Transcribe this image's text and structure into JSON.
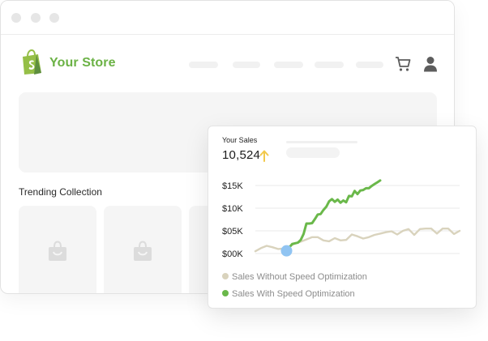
{
  "store": {
    "name": "Your Store",
    "brand_color": "#6bb245",
    "logo_icon": "shopify-bag-icon"
  },
  "header": {
    "icons": [
      "cart-icon",
      "user-icon"
    ]
  },
  "trending": {
    "title": "Trending Collection"
  },
  "sales_card": {
    "label": "Your Sales",
    "value": "10,524",
    "trend_icon": "up-arrow-icon",
    "trend_color": "#f2c94c"
  },
  "chart_data": {
    "type": "line",
    "y_tick_labels": [
      "$15K",
      "$10K",
      "$05K",
      "$00K"
    ],
    "y_ticks": [
      15,
      10,
      5,
      0
    ],
    "ylim": [
      0,
      15
    ],
    "xlim": [
      0,
      36
    ],
    "grid": true,
    "legend_placement": "bottom-left",
    "marker": {
      "x": 5.5,
      "y": 0.6,
      "color": "#90c4f2"
    },
    "series": [
      {
        "name": "Sales Without Speed Optimization",
        "color": "#d9d3bd",
        "x": [
          0,
          1,
          2,
          3,
          4,
          5,
          6,
          7,
          8,
          9,
          10,
          11,
          12,
          13,
          14,
          15,
          16,
          17,
          18,
          19,
          20,
          21,
          22,
          23,
          24,
          25,
          26,
          27,
          28,
          29,
          30,
          31,
          32,
          33,
          34,
          35,
          36
        ],
        "y": [
          0.5,
          1.2,
          1.7,
          1.4,
          1.0,
          1.1,
          1.6,
          2.2,
          2.6,
          3.1,
          3.6,
          3.6,
          2.9,
          2.7,
          3.4,
          2.9,
          3.0,
          4.2,
          3.8,
          3.3,
          3.6,
          4.1,
          4.4,
          4.7,
          4.9,
          4.2,
          5.0,
          5.4,
          4.1,
          5.4,
          5.5,
          5.5,
          4.4,
          5.5,
          5.5,
          4.3,
          5.0
        ]
      },
      {
        "name": "Sales With Speed Optimization",
        "color": "#6ab84a",
        "x": [
          5.5,
          6.5,
          7.5,
          8,
          8.5,
          9,
          9.5,
          10,
          10.5,
          11,
          11.5,
          12,
          12.5,
          13,
          13.5,
          14,
          14.5,
          15,
          15.5,
          16,
          16.5,
          17,
          17.5,
          18,
          18.5,
          19,
          19.5,
          20,
          20.5,
          21,
          21.5,
          22
        ],
        "y": [
          0.6,
          2.1,
          2.4,
          3.0,
          4.3,
          6.6,
          6.6,
          6.7,
          7.6,
          8.6,
          8.7,
          9.6,
          10.3,
          11.5,
          12.0,
          11.4,
          11.9,
          11.2,
          11.7,
          11.3,
          12.7,
          12.6,
          13.8,
          13.1,
          13.9,
          14.0,
          14.4,
          14.4,
          14.9,
          15.3,
          15.7,
          16.1
        ]
      }
    ]
  },
  "legend": {
    "items": [
      {
        "label": "Sales Without Speed Optimization",
        "color": "#d9d3bd"
      },
      {
        "label": "Sales With Speed Optimization",
        "color": "#6ab84a"
      }
    ]
  }
}
